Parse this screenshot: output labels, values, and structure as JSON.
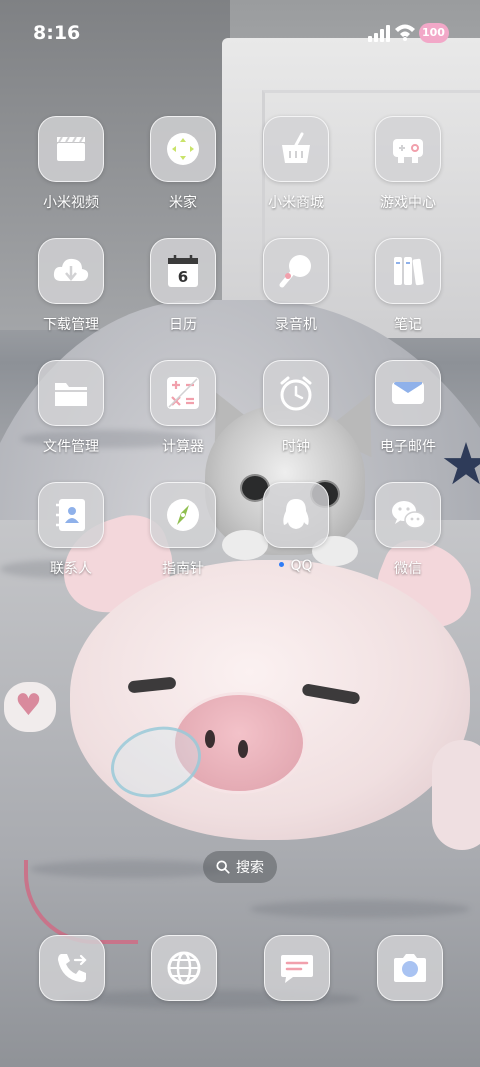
{
  "status_bar": {
    "time": "8:16",
    "battery": "100",
    "icons": [
      "signal-icon",
      "wifi-icon",
      "battery-icon"
    ]
  },
  "apps": [
    {
      "label": "小米视频",
      "icon": "clapperboard-icon"
    },
    {
      "label": "米家",
      "icon": "mijia-icon"
    },
    {
      "label": "小米商城",
      "icon": "shopping-basket-icon"
    },
    {
      "label": "游戏中心",
      "icon": "gamepad-icon"
    },
    {
      "label": "下载管理",
      "icon": "cloud-download-icon"
    },
    {
      "label": "日历",
      "icon": "calendar-icon",
      "calendar_day": "6"
    },
    {
      "label": "录音机",
      "icon": "microphone-icon"
    },
    {
      "label": "笔记",
      "icon": "notebooks-icon"
    },
    {
      "label": "文件管理",
      "icon": "folder-icon"
    },
    {
      "label": "计算器",
      "icon": "calculator-icon"
    },
    {
      "label": "时钟",
      "icon": "alarm-clock-icon"
    },
    {
      "label": "电子邮件",
      "icon": "envelope-icon"
    },
    {
      "label": "联系人",
      "icon": "contact-book-icon"
    },
    {
      "label": "指南针",
      "icon": "compass-icon"
    },
    {
      "label": "QQ",
      "icon": "qq-penguin-icon",
      "new_indicator": true
    },
    {
      "label": "微信",
      "icon": "wechat-icon"
    }
  ],
  "search": {
    "label": "搜索",
    "icon": "search-icon"
  },
  "dock": [
    {
      "name": "phone",
      "icon": "phone-icon"
    },
    {
      "name": "browser",
      "icon": "globe-icon"
    },
    {
      "name": "messages",
      "icon": "message-icon"
    },
    {
      "name": "camera",
      "icon": "camera-icon"
    }
  ],
  "colors": {
    "tile_bg": "#d2d2d4",
    "icon_stroke": "#ffffff",
    "accent_mijia": "#c9e36a",
    "accent_compass": "#8fbf4f",
    "accent_mail": "#8fb1ea",
    "accent_camera": "#a9c3f2",
    "accent_message": "#f1a0ac",
    "qq_dot": "#2f7cf6",
    "battery_pink": "#f2a8c8"
  }
}
